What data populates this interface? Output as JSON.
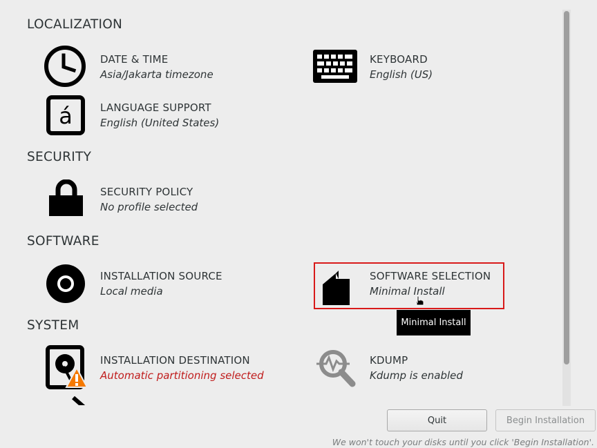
{
  "sections": {
    "localization": "LOCALIZATION",
    "security": "SECURITY",
    "software": "SOFTWARE",
    "system": "SYSTEM"
  },
  "spokes": {
    "date_time": {
      "title": "DATE & TIME",
      "status": "Asia/Jakarta timezone",
      "icon": "clock-icon"
    },
    "keyboard": {
      "title": "KEYBOARD",
      "status": "English (US)",
      "icon": "keyboard-icon"
    },
    "language": {
      "title": "LANGUAGE SUPPORT",
      "status": "English (United States)",
      "icon": "language-icon",
      "glyph": "á"
    },
    "security_policy": {
      "title": "SECURITY POLICY",
      "status": "No profile selected",
      "icon": "padlock-icon"
    },
    "install_source": {
      "title": "INSTALLATION SOURCE",
      "status": "Local media",
      "icon": "disc-icon"
    },
    "software_selection": {
      "title": "SOFTWARE SELECTION",
      "status": "Minimal Install",
      "icon": "package-icon"
    },
    "install_destination": {
      "title": "INSTALLATION DESTINATION",
      "status": "Automatic partitioning selected",
      "icon": "harddisk-icon",
      "status_color": "#c01c1c"
    },
    "kdump": {
      "title": "KDUMP",
      "status": "Kdump is enabled",
      "icon": "magnifier-icon"
    }
  },
  "tooltip": "Minimal Install",
  "buttons": {
    "quit": "Quit",
    "begin": "Begin Installation"
  },
  "footer_note": "We won't touch your disks until you click 'Begin Installation'.",
  "colors": {
    "background": "#ededed",
    "selection_border": "#d81919",
    "warning": "#f57900",
    "error_text": "#c01c1c"
  }
}
